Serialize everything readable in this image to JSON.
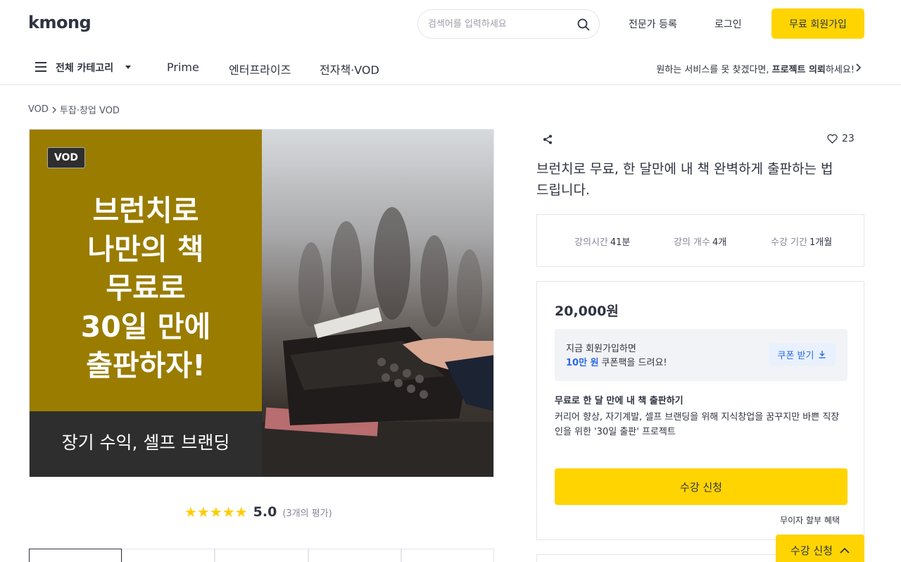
{
  "header": {
    "logo": "kmong",
    "search_placeholder": "검색어를 입력하세요",
    "expert_register": "전문가 등록",
    "login": "로그인",
    "signup": "무료 회원가입"
  },
  "nav": {
    "all_categories": "전체 카테고리",
    "items": [
      "Prime",
      "엔터프라이즈",
      "전자책·VOD"
    ],
    "right_text_prefix": "원하는 서비스를 못 찾겠다면,",
    "right_text_bold": "프로젝트 의뢰",
    "right_text_suffix": "하세요!"
  },
  "breadcrumb": {
    "level1": "VOD",
    "level2": "투잡·창업 VOD"
  },
  "hero": {
    "badge": "VOD",
    "title": "브런치로\n나만의 책\n무료로\n30일 만에\n출판하자!",
    "subtitle": "장기 수익, 셀프 브랜딩",
    "left_color": "#9a7c00"
  },
  "rating": {
    "stars": "★★★★★",
    "score": "5.0",
    "count": "(3개의 평가)"
  },
  "product": {
    "likes": "23",
    "title": "브런치로 무료, 한 달만에 내 책 완벽하게 출판하는 법 드립니다."
  },
  "meta": {
    "duration_label": "강의시간",
    "duration_value": "41분",
    "count_label": "강의 개수",
    "count_value": "4개",
    "period_label": "수강 기간",
    "period_value": "1개월"
  },
  "pricing": {
    "price": "20,000원",
    "coupon_line1": "지금 회원가입하면",
    "coupon_amount": "10만 원",
    "coupon_line2_rest": "쿠폰팩을 드려요!",
    "coupon_button": "쿠폰 받기",
    "package_title": "무료로 한 달 만에 내 책 출판하기",
    "package_desc": "커리어 향상, 자기계발, 셀프 브랜딩을 위해 지식창업을 꿈꾸지만 바쁜 직장인을 위한 '30일 출판' 프로젝트",
    "enroll": "수강 신청",
    "installment": "무이자 할부 혜택"
  },
  "floating": {
    "label": "수강 신청"
  },
  "colors": {
    "brand_yellow": "#ffd400",
    "link_blue": "#2d69e3",
    "star": "#ffcd00"
  }
}
